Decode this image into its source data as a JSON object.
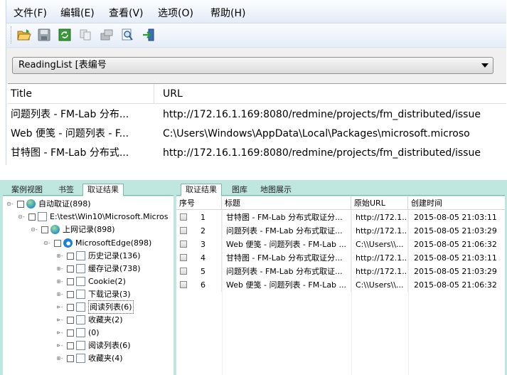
{
  "menu": {
    "items": [
      "文件(F)",
      "编辑(E)",
      "查看(V)",
      "选项(O)",
      "帮助(H)"
    ]
  },
  "toolbar": {
    "buttons": [
      "open-folder-icon",
      "save-icon",
      "refresh-icon",
      "copy-icon",
      "export-icon",
      "search-doc-icon",
      "exit-icon"
    ]
  },
  "table_selector": {
    "value": "ReadingList   [表编号"
  },
  "grid": {
    "columns": [
      "Title",
      "URL"
    ],
    "rows": [
      {
        "title": "问题列表 - FM-Lab 分布...",
        "url": "http://172.16.1.169:8080/redmine/projects/fm_distributed/issue"
      },
      {
        "title": "Web 便笺 - 问题列表 - F...",
        "url": "C:\\Users\\Windows\\AppData\\Local\\Packages\\microsoft.microso"
      },
      {
        "title": "甘特图 - FM-Lab 分布式...",
        "url": "http://172.16.1.169:8080/redmine/projects/fm_distributed/issue"
      }
    ]
  },
  "left_tabs": [
    "案例视图",
    "书签",
    "取证结果"
  ],
  "tree": [
    {
      "label": "自动取证(898)",
      "icon": "globe-icon"
    },
    {
      "label": "E:\\test\\Win10\\Microsoft.Micros",
      "icon": "doc-icon"
    },
    {
      "label": "上网记录(898)",
      "icon": "globe-icon"
    },
    {
      "label": "MicrosoftEdge(898)",
      "icon": "edge-icon"
    },
    {
      "label": "历史记录(136)",
      "icon": "doc-icon"
    },
    {
      "label": "缓存记录(738)",
      "icon": "doc-icon"
    },
    {
      "label": "Cookie(2)",
      "icon": "doc-icon"
    },
    {
      "label": "下载记录(3)",
      "icon": "doc-icon"
    },
    {
      "label": "阅读列表(6)",
      "icon": "doc-icon"
    },
    {
      "label": "收藏夹(2)",
      "icon": "doc-icon"
    },
    {
      "label": "(0)",
      "icon": "doc-icon"
    },
    {
      "label": "阅读列表(6)",
      "icon": "doc-icon"
    },
    {
      "label": "收藏夹(4)",
      "icon": "doc-icon"
    }
  ],
  "right_tabs": [
    "取证结果",
    "图库",
    "地图展示"
  ],
  "results": {
    "columns": [
      "序号",
      "标题",
      "原始URL",
      "创建时间"
    ],
    "rows": [
      {
        "no": "1",
        "title": "甘特图 - FM-Lab 分布式取证分...",
        "url": "http://172.1...",
        "time": "2015-08-05 21:03:11"
      },
      {
        "no": "2",
        "title": "问题列表 - FM-Lab 分布式取证...",
        "url": "http://172.1...",
        "time": "2015-08-05 21:03:29"
      },
      {
        "no": "3",
        "title": "Web 便笺 - 问题列表 - FM-Lab ...",
        "url": "C:\\\\Users\\\\...",
        "time": "2015-08-05 21:06:32"
      },
      {
        "no": "4",
        "title": "甘特图 - FM-Lab 分布式取证分...",
        "url": "http://172.1...",
        "time": "2015-08-05 21:03:11"
      },
      {
        "no": "5",
        "title": "问题列表 - FM-Lab 分布式取证...",
        "url": "http://172.1...",
        "time": "2015-08-05 21:03:29"
      },
      {
        "no": "6",
        "title": "Web 便笺 - 问题列表 - FM-Lab ...",
        "url": "C:\\\\Users\\\\...",
        "time": "2015-08-05 21:06:32"
      }
    ]
  }
}
